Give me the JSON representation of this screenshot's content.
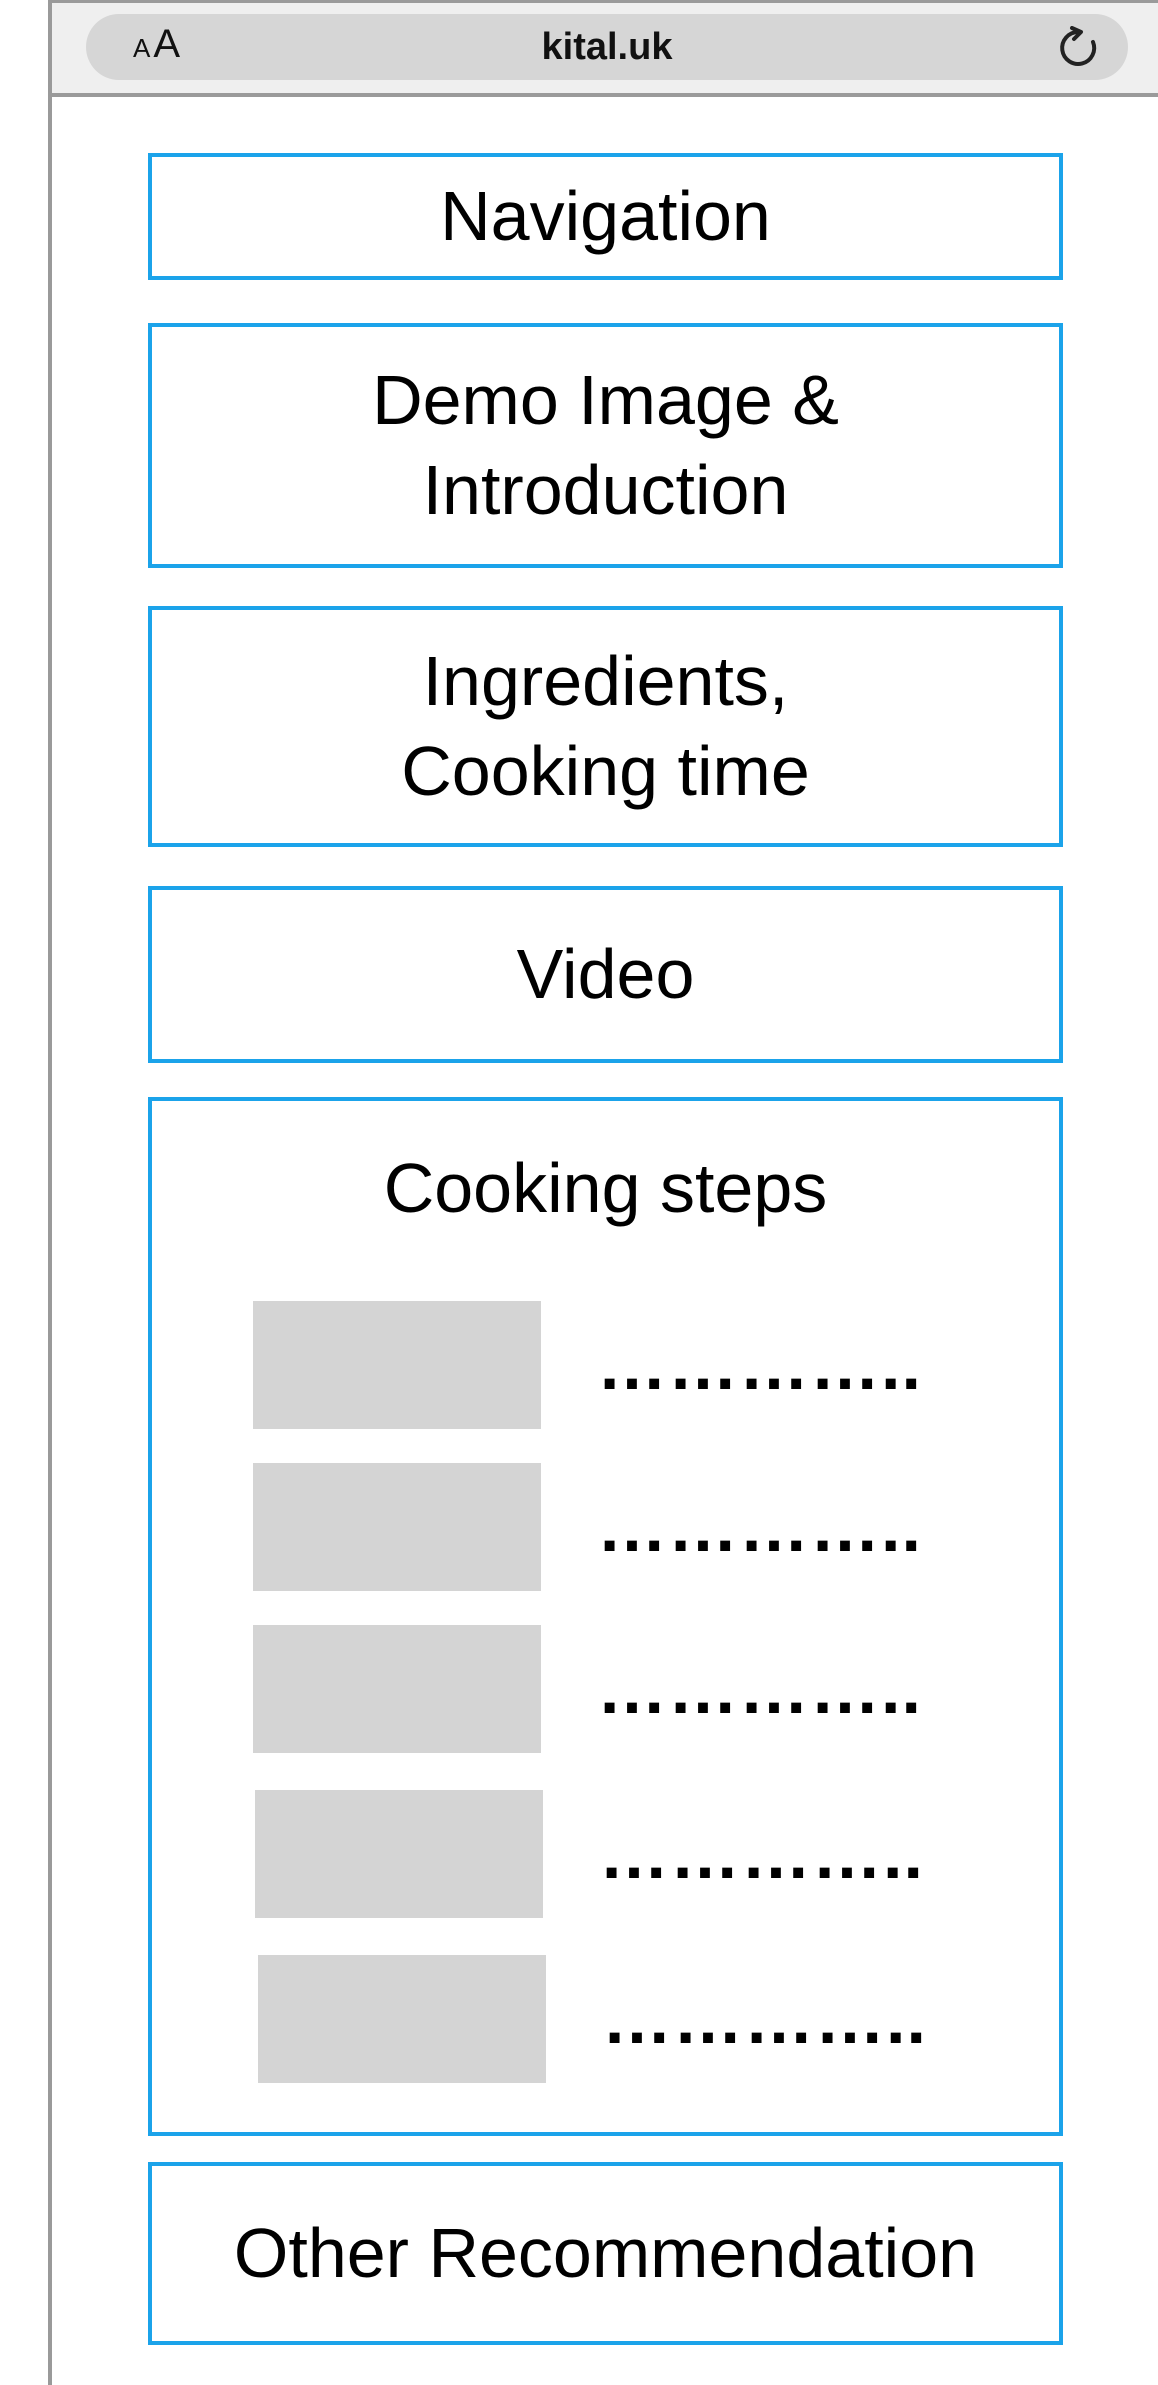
{
  "browser": {
    "text_size_small": "A",
    "text_size_large": "A",
    "url": "kital.uk",
    "reload_icon": "reload-icon"
  },
  "sections": {
    "navigation": "Navigation",
    "demo": "Demo Image &\nIntroduction",
    "ingredients": "Ingredients,\nCooking time",
    "video": "Video",
    "cooking_steps": {
      "title": "Cooking steps",
      "steps": [
        {
          "placeholder": "…………..",
          "thumb_icon": "image-placeholder"
        },
        {
          "placeholder": "…………..",
          "thumb_icon": "image-placeholder"
        },
        {
          "placeholder": "…………..",
          "thumb_icon": "image-placeholder"
        },
        {
          "placeholder": "…………..",
          "thumb_icon": "image-placeholder"
        },
        {
          "placeholder": "…………..",
          "thumb_icon": "image-placeholder"
        }
      ]
    },
    "other": "Other Recommendation"
  },
  "colors": {
    "accent_border": "#1ba3ea",
    "placeholder_fill": "#d4d4d4",
    "chrome_bar": "#d6d6d6"
  }
}
